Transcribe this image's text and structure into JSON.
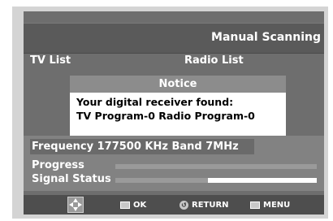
{
  "title": "Manual Scanning",
  "lists": {
    "tv": "TV List",
    "radio": "Radio List"
  },
  "notice": {
    "header": "Notice",
    "line1": "Your digital receiver found:",
    "line2": "TV Program-0 Radio Program-0"
  },
  "frequency_text": "Frequency 177500 KHz Band 7MHz",
  "progress": {
    "label": "Progress",
    "value_pct": 0
  },
  "signal": {
    "label": "Signal Status",
    "value_pct": 54
  },
  "nav": {
    "move_icon": "dpad-icon",
    "ok": "OK",
    "return": "RETURN",
    "menu": "MENU"
  },
  "colors": {
    "screen_bg": "#6e6e6e",
    "title_bg": "#5a5a5a",
    "notice_header": "#8c8c8c"
  }
}
